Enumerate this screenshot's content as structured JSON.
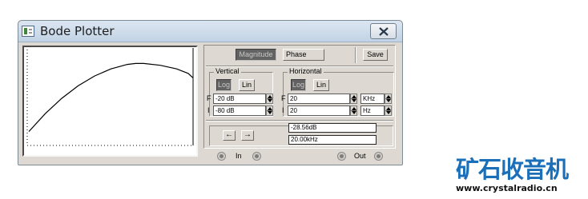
{
  "window": {
    "title": "Bode Plotter"
  },
  "mode": {
    "magnitude_label": "Magnitude",
    "phase_label": "Phase",
    "save_label": "Save",
    "active": "Magnitude"
  },
  "vertical": {
    "title": "Vertical",
    "log_label": "Log",
    "lin_label": "Lin",
    "active": "Log",
    "f_label": "F",
    "f_value": "-20 dB",
    "i_label": "I",
    "i_value": "-80 dB"
  },
  "horizontal": {
    "title": "Horizontal",
    "log_label": "Log",
    "lin_label": "Lin",
    "active": "Log",
    "f_label": "F",
    "f_value": "20",
    "f_unit": "KHz",
    "i_label": "I",
    "i_value": "20",
    "i_unit": "Hz"
  },
  "cursor": {
    "left_arrow": "←",
    "right_arrow": "→",
    "magnitude_readout": "-28.56dB",
    "frequency_readout": "20.00kHz"
  },
  "terminals": {
    "in_label": "In",
    "out_label": "Out"
  },
  "watermark": {
    "logo_text": "矿石收音机",
    "url": "www.crystalradio.cn"
  },
  "colors": {
    "window_bg": "#ddd9d2",
    "active_button": "#626262",
    "logo_blue": "#1b6fb8"
  },
  "chart_data": {
    "type": "line",
    "x_scale": "log",
    "x_range": [
      "20 Hz",
      "20 kHz"
    ],
    "y_range_db": [
      -80,
      -20
    ],
    "series": [
      {
        "points_rel": [
          [
            0.0,
            0.12
          ],
          [
            0.1,
            0.32
          ],
          [
            0.2,
            0.49
          ],
          [
            0.3,
            0.63
          ],
          [
            0.4,
            0.74
          ],
          [
            0.5,
            0.82
          ],
          [
            0.6,
            0.87
          ],
          [
            0.65,
            0.88
          ],
          [
            0.7,
            0.88
          ],
          [
            0.8,
            0.86
          ],
          [
            0.9,
            0.82
          ],
          [
            0.97,
            0.77
          ],
          [
            1.0,
            0.72
          ]
        ]
      }
    ],
    "cursor_value_db": -28.56,
    "cursor_freq": "20.00kHz"
  }
}
